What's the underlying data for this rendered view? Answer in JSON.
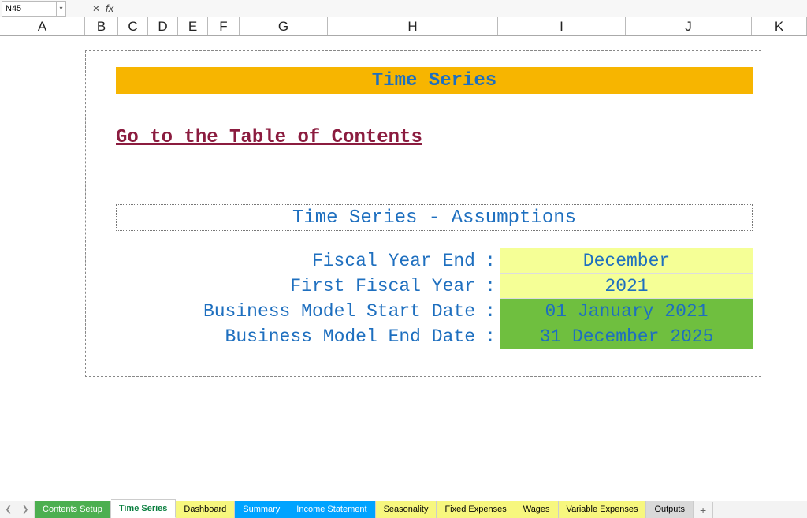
{
  "formula_bar": {
    "cell_ref": "N45",
    "fx": "fx"
  },
  "columns": [
    "A",
    "B",
    "C",
    "D",
    "E",
    "F",
    "G",
    "H",
    "I",
    "J",
    "K"
  ],
  "panel": {
    "title": "Time Series",
    "toc_link": "Go to the Table of Contents",
    "section_header": "Time Series - Assumptions",
    "rows": [
      {
        "label": "Fiscal Year End",
        "value": "December",
        "style": "yellow"
      },
      {
        "label": "First Fiscal Year",
        "value": "2021",
        "style": "yellow"
      },
      {
        "label": "Business Model Start Date",
        "value": "01 January 2021",
        "style": "green"
      },
      {
        "label": "Business Model End Date",
        "value": "31 December 2025",
        "style": "green"
      }
    ]
  },
  "tabs": [
    {
      "label": "Contents Setup",
      "style": "green-tab"
    },
    {
      "label": "Time Series",
      "style": "active"
    },
    {
      "label": "Dashboard",
      "style": "yellow-tab"
    },
    {
      "label": "Summary",
      "style": "blue-tab"
    },
    {
      "label": "Income Statement",
      "style": "blue-tab"
    },
    {
      "label": "Seasonality",
      "style": "yellow-tab"
    },
    {
      "label": "Fixed Expenses",
      "style": "yellow-tab"
    },
    {
      "label": "Wages",
      "style": "yellow-tab"
    },
    {
      "label": "Variable Expenses",
      "style": "yellow-tab"
    },
    {
      "label": "Outputs",
      "style": "grey-tab"
    }
  ],
  "nav_glyphs": {
    "first": "❮",
    "prev": "❯",
    "add": "+"
  }
}
